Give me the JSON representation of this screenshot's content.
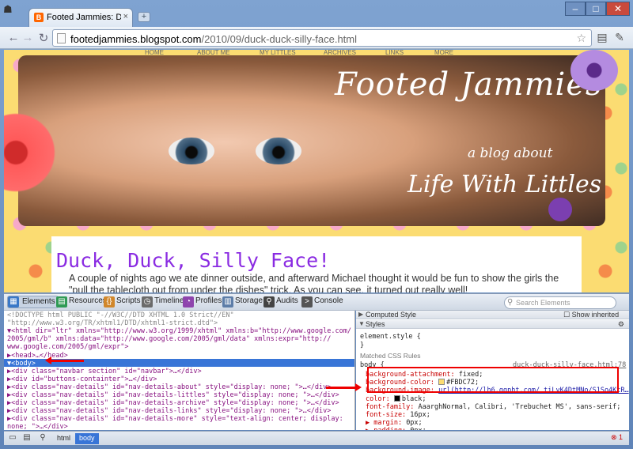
{
  "browser": {
    "tab_title": "Footed Jammies: Duck, D...",
    "tab_close": "×",
    "new_tab": "+",
    "window_controls": [
      "–",
      "□",
      "✕"
    ],
    "url_host": "footedjammies.blogspot.com",
    "url_path": "/2010/09/duck-duck-silly-face.html",
    "back": "←",
    "forward": "→",
    "reload": "↻"
  },
  "blog": {
    "nav": [
      "HOME",
      "ABOUT ME",
      "MY LITTLES",
      "ARCHIVES",
      "LINKS",
      "MORE"
    ],
    "header_title": "Footed Jammies",
    "header_sub1": "a blog about",
    "header_sub2": "Life With Littles",
    "post_title": "Duck, Duck, Silly Face!",
    "post_text": "A couple of nights ago we ate dinner outside, and afterward Michael thought it would be fun to show the girls the \"pull the tablecloth out from under the dishes\" trick. As you can see, it turned out really well!"
  },
  "devtools": {
    "tabs": [
      {
        "label": "Elements",
        "color": "#3a78c7"
      },
      {
        "label": "Resources",
        "color": "#2f9a55"
      },
      {
        "label": "Scripts",
        "color": "#d1872b"
      },
      {
        "label": "Timeline",
        "color": "#6b6b6b"
      },
      {
        "label": "Profiles",
        "color": "#8e44ad"
      },
      {
        "label": "Storage",
        "color": "#5d7da8"
      },
      {
        "label": "Audits",
        "color": "#444444"
      },
      {
        "label": "Console",
        "color": "#555555"
      }
    ],
    "search_placeholder": "Search Elements",
    "dom_lines": [
      {
        "text": "<!DOCTYPE html PUBLIC \"-//W3C//DTD XHTML 1.0 Strict//EN\"",
        "kind": "cm"
      },
      {
        "text": "  \"http://www.w3.org/TR/xhtml1/DTD/xhtml1-strict.dtd\">",
        "kind": "cm"
      },
      {
        "text": "▼<html dir=\"ltr\" xmlns=\"http://www.w3.org/1999/xhtml\" xmlns:b=\"http://www.google.com/",
        "kind": "tag"
      },
      {
        "text": "  2005/gml/b\" xmlns:data=\"http://www.google.com/2005/gml/data\" xmlns:expr=\"http://",
        "kind": "tag"
      },
      {
        "text": "  www.google.com/2005/gml/expr\">",
        "kind": "tag"
      },
      {
        "text": "  ▶<head>…</head>",
        "kind": "tag"
      },
      {
        "text": "▼<body>",
        "kind": "sel"
      },
      {
        "text": "    ▶<div class=\"navbar section\" id=\"navbar\">…</div>",
        "kind": "tag"
      },
      {
        "text": "    ▶<div id=\"buttons-containter\">…</div>",
        "kind": "tag"
      },
      {
        "text": "    ▶<div class=\"nav-details\" id=\"nav-details-about\" style=\"display: none; \">…</div>",
        "kind": "tag"
      },
      {
        "text": "    ▶<div class=\"nav-details\" id=\"nav-details-littles\" style=\"display: none; \">…</div>",
        "kind": "tag"
      },
      {
        "text": "    ▶<div class=\"nav-details\" id=\"nav-details-archive\" style=\"display: none; \">…</div>",
        "kind": "tag"
      },
      {
        "text": "    ▶<div class=\"nav-details\" id=\"nav-details-links\" style=\"display: none; \">…</div>",
        "kind": "tag"
      },
      {
        "text": "    ▶<div class=\"nav-details\" id=\"nav-details-more\" style=\"text-align: center; display:",
        "kind": "tag"
      },
      {
        "text": "      none; \">…</div>",
        "kind": "tag"
      }
    ],
    "styles": {
      "computed_label": "Computed Style",
      "show_inherited": "Show inherited",
      "styles_label": "Styles",
      "element_style": "element.style {",
      "close_brace": "}",
      "matched_label": "Matched CSS Rules",
      "rule_selector": "body {",
      "rule_source": "duck-duck-silly-face.html:78",
      "props": [
        {
          "name": "background-attachment",
          "value": "fixed;"
        },
        {
          "name": "background-color",
          "value": "#FBDC72;",
          "swatch": "#FBDC72"
        },
        {
          "name": "background-image",
          "value": "url(http://lh6.ggpht.com/_tiLvK4DtMNo/S1So4KtR…"
        },
        {
          "name": "color",
          "value": "black;",
          "swatch": "#000000"
        },
        {
          "name": "font-family",
          "value": "AaarghNormal, Calibri, 'Trebuchet MS', sans-serif;"
        },
        {
          "name": "font-size",
          "value": "16px;"
        },
        {
          "name": "▶ margin",
          "value": "0px;"
        },
        {
          "name": "▶ padding",
          "value": "0px;"
        }
      ]
    },
    "breadcrumbs": [
      "html",
      "body"
    ],
    "error_count": "1"
  }
}
